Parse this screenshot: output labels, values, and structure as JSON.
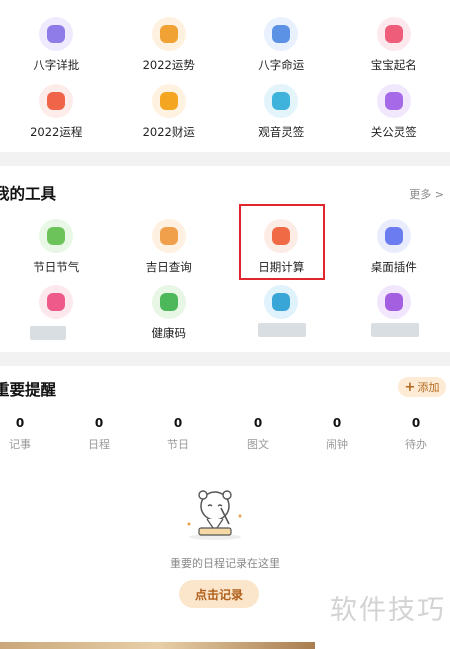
{
  "top_grid": [
    {
      "label": "八字详批",
      "icon": "bazi-detail-icon",
      "bg": "#efeafe",
      "fg": "#8f7ce8",
      "glyph": "●"
    },
    {
      "label": "2022运势",
      "icon": "fortune-2022-icon",
      "bg": "#fff1df",
      "fg": "#f0a235",
      "glyph": "✎"
    },
    {
      "label": "八字命运",
      "icon": "bazi-fate-icon",
      "bg": "#e8f1fd",
      "fg": "#5b92e6",
      "glyph": "◡"
    },
    {
      "label": "宝宝起名",
      "icon": "baby-name-icon",
      "bg": "#fde8ee",
      "fg": "#ee5d7a",
      "glyph": "●"
    },
    {
      "label": "2022运程",
      "icon": "fortune-path-icon",
      "bg": "#fdecea",
      "fg": "#f0644a",
      "glyph": "◆"
    },
    {
      "label": "2022财运",
      "icon": "wealth-icon",
      "bg": "#fff2e0",
      "fg": "#f4a623",
      "glyph": "●"
    },
    {
      "label": "观音灵签",
      "icon": "guanyin-lot-icon",
      "bg": "#e3f4fb",
      "fg": "#3fb3dc",
      "glyph": "♦"
    },
    {
      "label": "关公灵签",
      "icon": "guangong-lot-icon",
      "bg": "#f1e8fd",
      "fg": "#a66ae8",
      "glyph": "▲"
    }
  ],
  "tools": {
    "title": "我的工具",
    "more": "更多 >",
    "items": [
      {
        "label": "节日节气",
        "icon": "festival-calendar-icon",
        "bg": "#e9f7e6",
        "fg": "#6cc35a",
        "glyph": "▦"
      },
      {
        "label": "吉日查询",
        "icon": "lucky-day-icon",
        "bg": "#fff1e2",
        "fg": "#f0a04b",
        "glyph": "●"
      },
      {
        "label": "日期计算",
        "icon": "date-calc-icon",
        "bg": "#fdece6",
        "fg": "#f06a45",
        "glyph": "▤"
      },
      {
        "label": "桌面插件",
        "icon": "desktop-widget-icon",
        "bg": "#e9ecfd",
        "fg": "#6a7cf0",
        "glyph": "⇅"
      },
      {
        "label": "",
        "icon": "avatar-style-icon",
        "bg": "#fde8ee",
        "fg": "#ee5a8a",
        "glyph": "◐"
      },
      {
        "label": "健康码",
        "icon": "health-code-icon",
        "bg": "#e8f6e6",
        "fg": "#4cb85a",
        "glyph": "▦"
      },
      {
        "label": "",
        "icon": "blurred-tool-icon",
        "bg": "#e0f2fb",
        "fg": "#39a6d8",
        "glyph": "▣"
      },
      {
        "label": "",
        "icon": "fan-tool-icon",
        "bg": "#f2e6fd",
        "fg": "#a45ee0",
        "glyph": "◗"
      }
    ]
  },
  "reminders": {
    "title": "重要提醒",
    "add_label": "添加",
    "stats": [
      {
        "value": "0",
        "label": "记事"
      },
      {
        "value": "0",
        "label": "日程"
      },
      {
        "value": "0",
        "label": "节日"
      },
      {
        "value": "0",
        "label": "图文"
      },
      {
        "value": "0",
        "label": "闹钟"
      },
      {
        "value": "0",
        "label": "待办"
      }
    ],
    "empty_text": "重要的日程记录在这里",
    "record_button": "点击记录"
  },
  "watermark": "软件技巧"
}
